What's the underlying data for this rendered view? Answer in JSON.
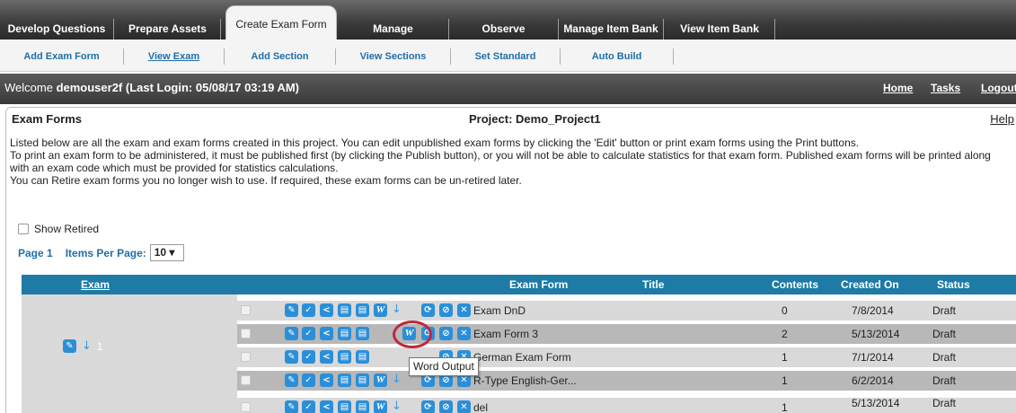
{
  "top_tabs": [
    "Develop Questions",
    "Prepare Assets",
    "Create Exam Form",
    "Manage",
    "Observe",
    "Manage Item Bank",
    "View Item Bank"
  ],
  "sub_menu": [
    "Add Exam Form",
    "View Exam",
    "Add Section",
    "View Sections",
    "Set Standard",
    "Auto Build"
  ],
  "welcome": {
    "prefix": "Welcome ",
    "user": "demouser2f",
    "last_login": " (Last Login: 05/08/17   03:19 AM)",
    "nav": [
      "Home",
      "Tasks",
      "Logout"
    ]
  },
  "panel": {
    "title": "Exam Forms",
    "project": "Project: Demo_Project1",
    "help": "Help",
    "desc1": "Listed below are all the exam and exam forms created in this project. You can edit unpublished exam forms by clicking the 'Edit' button or print exam forms using the Print buttons.",
    "desc2": "To print an exam form to be administered, it must be published first (by clicking the Publish button), or you will not be able to calculate statistics for that exam form. Published exam forms will be printed along with an exam code which must be provided for statistics calculations.",
    "desc3": "You can Retire exam forms you no longer wish to use. If required, these exam forms can be un-retired later.",
    "show_retired": "Show Retired",
    "page": "Page 1",
    "items_per_page_label": "Items Per Page:",
    "items_per_page_value": "10 ▾"
  },
  "table": {
    "headers": {
      "exam": "Exam",
      "exam_form": "Exam Form",
      "title": "Title",
      "contents": "Contents",
      "created_on": "Created On",
      "status": "Status"
    },
    "exam_number": "1",
    "rows": [
      {
        "form": "Exam DnD",
        "contents": "0",
        "created": "7/8/2014",
        "status": "Draft"
      },
      {
        "form": "Exam Form 3",
        "contents": "2",
        "created": "5/13/2014",
        "status": "Draft"
      },
      {
        "form": "German Exam Form",
        "contents": "1",
        "created": "7/1/2014",
        "status": "Draft"
      },
      {
        "form": "R-Type English-Ger...",
        "contents": "1",
        "created": "6/2/2014",
        "status": "Draft"
      },
      {
        "form": "del",
        "contents": "1",
        "created": "5/13/2014",
        "status": "Draft"
      }
    ]
  },
  "tooltip": "Word Output",
  "icons": {
    "edit": "✎",
    "check": "✓",
    "share": "<",
    "doc": "▤",
    "word": "W",
    "down": "↓",
    "publish": "⟳",
    "retire": "⊘",
    "delete": "✕"
  },
  "colors": {
    "header_blue": "#1d7ba6",
    "link_blue": "#1f6fa8",
    "icon_blue": "#2b8fd8",
    "highlight": "#c0283a"
  }
}
